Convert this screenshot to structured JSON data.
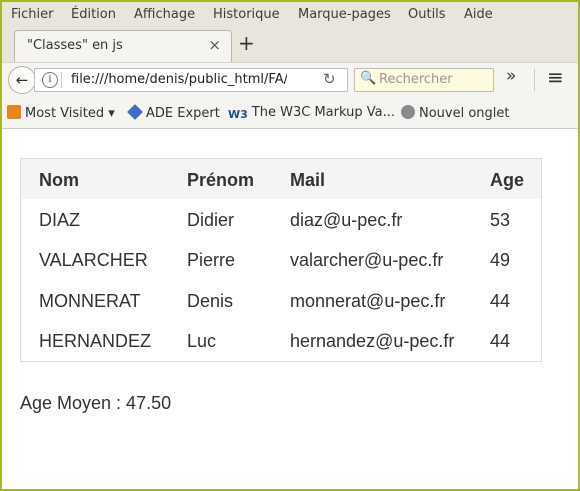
{
  "menu": [
    "Fichier",
    "Édition",
    "Affichage",
    "Historique",
    "Marque-pages",
    "Outils",
    "Aide"
  ],
  "tab": {
    "title": "\"Classes\" en js",
    "close_glyph": "×"
  },
  "new_tab_glyph": "+",
  "nav": {
    "url": "file:///home/denis/public_html/FA/p",
    "search_placeholder": "Rechercher",
    "overflow_glyph": "»",
    "menu_glyph": "≡"
  },
  "bookmarks": [
    "Most Visited",
    "ADE Expert",
    "The W3C Markup Va...",
    "Nouvel onglet"
  ],
  "table": {
    "headers": [
      "Nom",
      "Prénom",
      "Mail",
      "Age"
    ],
    "rows": [
      [
        "DIAZ",
        "Didier",
        "diaz@u-pec.fr",
        "53"
      ],
      [
        "VALARCHER",
        "Pierre",
        "valarcher@u-pec.fr",
        "49"
      ],
      [
        "MONNERAT",
        "Denis",
        "monnerat@u-pec.fr",
        "44"
      ],
      [
        "HERNANDEZ",
        "Luc",
        "hernandez@u-pec.fr",
        "44"
      ]
    ]
  },
  "average_label": "Age Moyen : 47.50",
  "colors": {
    "window_border": "#a5b631",
    "chrome_bg": "#e8e5dc",
    "table_header_bg": "#f4f4f4"
  }
}
